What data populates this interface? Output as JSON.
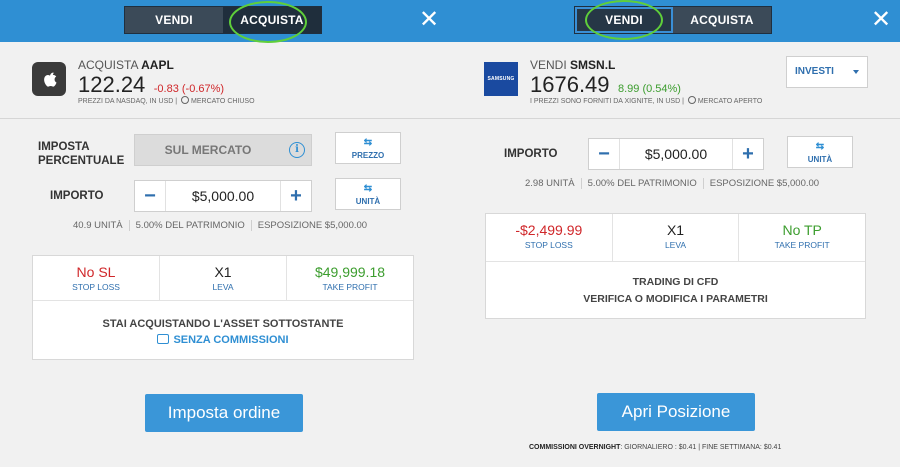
{
  "left": {
    "tabs": {
      "sell": "VENDI",
      "buy": "ACQUISTA"
    },
    "close_glyph": "✕",
    "asset": {
      "action": "ACQUISTA",
      "symbol": "AAPL",
      "logo_glyph": "",
      "price": "122.24",
      "change": "-0.83 (-0.67%)",
      "note": "PREZZI DA NASDAQ, IN USD",
      "market_status": "MERCATO CHIUSO"
    },
    "rate": {
      "label_line1": "IMPOSTA",
      "label_line2": "PERCENTUALE",
      "market_text": "SUL MERCATO",
      "info_glyph": "i",
      "button_arrows": "⇆",
      "button_label": "PREZZO"
    },
    "amount": {
      "label": "IMPORTO",
      "minus": "−",
      "value": "$5,000.00",
      "plus": "+",
      "button_arrows": "⇆",
      "button_label": "UNITÀ"
    },
    "stats": [
      "40.9 UNITÀ",
      "5.00% DEL PATRIMONIO",
      "ESPOSIZIONE $5,000.00"
    ],
    "card": {
      "cells": [
        {
          "value": "No SL",
          "key": "STOP LOSS",
          "color": "#d0272a"
        },
        {
          "value": "X1",
          "key": "LEVA",
          "color": "#222222"
        },
        {
          "value": "$49,999.18",
          "key": "TAKE PROFIT",
          "color": "#3c9d2e"
        }
      ],
      "footer": "STAI ACQUISTANDO L'ASSET SOTTOSTANTE",
      "link": "SENZA COMMISSIONI"
    },
    "primary_button": "Imposta ordine"
  },
  "right": {
    "tabs": {
      "sell": "VENDI",
      "buy": "ACQUISTA"
    },
    "close_glyph": "✕",
    "asset": {
      "action": "VENDI",
      "symbol": "SMSN.L",
      "logo_text": "SAMSUNG",
      "price": "1676.49",
      "change": "8.99 (0.54%)",
      "note": "I PREZZI SONO FORNITI DA XIGNITE, IN USD",
      "market_status": "MERCATO APERTO"
    },
    "invest": {
      "label": "INVESTI"
    },
    "amount": {
      "label": "IMPORTO",
      "minus": "−",
      "value": "$5,000.00",
      "plus": "+",
      "button_arrows": "⇆",
      "button_label": "UNITÀ"
    },
    "stats": [
      "2.98 UNITÀ",
      "5.00% DEL PATRIMONIO",
      "ESPOSIZIONE $5,000.00"
    ],
    "card": {
      "cells": [
        {
          "value": "-$2,499.99",
          "key": "STOP LOSS",
          "color": "#d0272a"
        },
        {
          "value": "X1",
          "key": "LEVA",
          "color": "#222222"
        },
        {
          "value": "No TP",
          "key": "TAKE PROFIT",
          "color": "#3c9d2e"
        }
      ],
      "cfd_line1": "TRADING DI CFD",
      "cfd_line2": "VERIFICA O MODIFICA I PARAMETRI"
    },
    "primary_button": "Apri Posizione",
    "overnight": {
      "label": "COMMISSIONI OVERNIGHT",
      "detail": ": GIORNALIERO : $0.41 | FINE SETTIMANA: $0.41"
    }
  },
  "colors": {
    "header_blue": "#2f8fd3",
    "highlight_green": "#5fcf3a",
    "button_blue": "#3a96d8"
  }
}
